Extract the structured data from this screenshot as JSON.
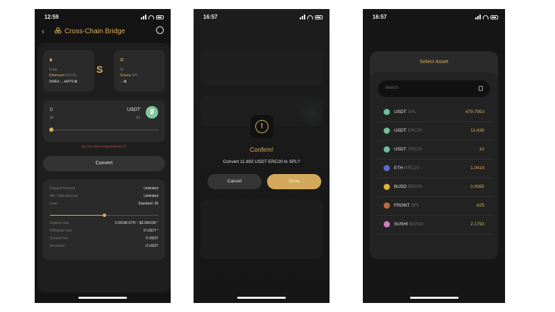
{
  "phone1": {
    "time": "12:59",
    "title": "Cross-Chain Bridge",
    "from": {
      "label": "From",
      "chain": "Ethereum",
      "standard": "ERC20",
      "address": "0x9Ed ... a6479"
    },
    "to": {
      "label": "To",
      "chain": "Solana",
      "standard": "SPL",
      "address": "..."
    },
    "amount": "0",
    "amount_usd": "$0",
    "token": "USDT",
    "token_usd": "$1",
    "warning": "Do not meet requirements (*)",
    "convert_label": "Convert",
    "details": [
      {
        "label": "Deposit Timeout",
        "value": "Unlimited"
      },
      {
        "label": "Min / Max Amount",
        "value": "Unlimited"
      },
      {
        "label": "Gear",
        "value": "Standard: 28"
      },
      {
        "label": "Deposit Gas",
        "value": "0.00196 ETH ~ $3.900106 *"
      },
      {
        "label": "Withdraw Gas",
        "value": "0 USDT *"
      },
      {
        "label": "Service Fee",
        "value": "0 USDT"
      },
      {
        "label": "Received",
        "value": "0 USDT"
      }
    ]
  },
  "phone2": {
    "time": "16:57",
    "dialog_title": "Confirm!",
    "message": "Convert 11.692 USDT ERC20 to SPL?",
    "cancel_label": "Cancel",
    "done_label": "Done"
  },
  "phone3": {
    "time": "16:57",
    "sheet_title": "Select Asset",
    "search_placeholder": "Search",
    "assets": [
      {
        "symbol": "USDT",
        "network": "SPL",
        "balance": "479.7953",
        "icon_color": "#6fbf98"
      },
      {
        "symbol": "USDT",
        "network": "ERC20",
        "balance": "13.439",
        "icon_color": "#6fbf98"
      },
      {
        "symbol": "USDT",
        "network": "TRC20",
        "balance": "10",
        "icon_color": "#6fbf98"
      },
      {
        "symbol": "ETH",
        "network": "ERC20",
        "balance": "1.0419",
        "icon_color": "#5a6ad0"
      },
      {
        "symbol": "BUSD",
        "network": "BEP20",
        "balance": "0.0085",
        "icon_color": "#e0b030"
      },
      {
        "symbol": "FRONT",
        "network": "SPL",
        "balance": "625",
        "icon_color": "#c06a40"
      },
      {
        "symbol": "SUSHI",
        "network": "BEP20",
        "balance": "2.1793",
        "icon_color": "#d080c0"
      }
    ]
  }
}
